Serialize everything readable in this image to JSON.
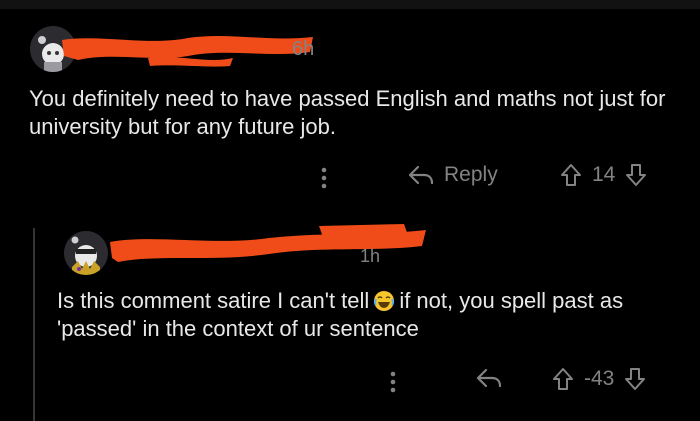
{
  "colors": {
    "background": "#000000",
    "text": "#e8e8e8",
    "muted": "#818384",
    "redaction": "#f04c1a",
    "thread_line": "#343536"
  },
  "comments": [
    {
      "time_suffix": "6h",
      "body": "You definitely need to have passed English and maths not just for university but for any future job.",
      "actions": {
        "more_icon": "more-vertical-icon",
        "reply_label": "Reply",
        "score": "14"
      }
    },
    {
      "time_suffix": "1h",
      "body_before_emoji": "Is this comment satire I can't tell",
      "emoji": "face-with-tears-of-joy",
      "body_after_emoji": "if not, you spell past as 'passed' in the context of ur sentence",
      "actions": {
        "more_icon": "more-vertical-icon",
        "score": "-43"
      }
    }
  ]
}
